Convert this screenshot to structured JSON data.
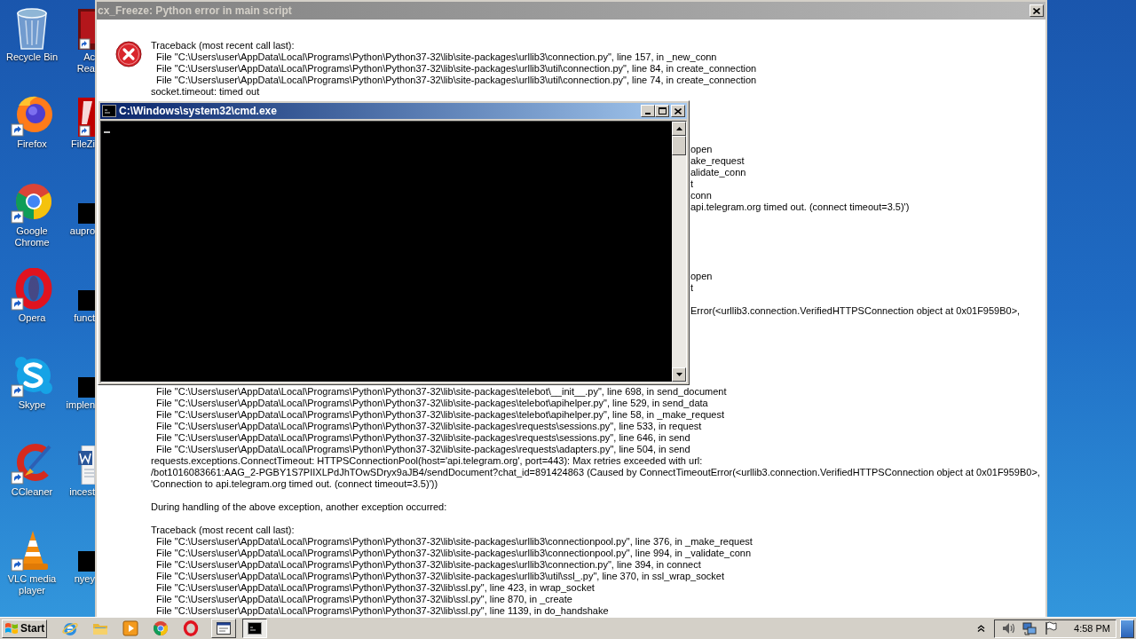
{
  "desktop": {
    "icons": [
      {
        "kind": "recycle",
        "label": "Recycle Bin"
      },
      {
        "kind": "firefox",
        "label": "Firefox"
      },
      {
        "kind": "chrome",
        "label": "Google Chrome"
      },
      {
        "kind": "opera",
        "label": "Opera"
      },
      {
        "kind": "skype",
        "label": "Skype"
      },
      {
        "kind": "ccleaner",
        "label": "CCleaner"
      },
      {
        "kind": "vlc",
        "label": "VLC media player"
      }
    ],
    "partial_icons": [
      {
        "kind": "reader",
        "label_lines": [
          "Ac",
          "Rea"
        ]
      },
      {
        "kind": "filezilla",
        "label_lines": [
          "FileZi"
        ]
      },
      {
        "kind": "blank",
        "label_lines": [
          "aupro"
        ]
      },
      {
        "kind": "blank",
        "label_lines": [
          "funct"
        ]
      },
      {
        "kind": "blank",
        "label_lines": [
          "implen"
        ]
      },
      {
        "kind": "document",
        "label_lines": [
          "incest"
        ]
      },
      {
        "kind": "blank",
        "label_lines": [
          "nyey"
        ]
      }
    ]
  },
  "dialog": {
    "title": "cx_Freeze: Python error in main script",
    "lines_above": [
      {
        "kind": "text",
        "text": "Traceback (most recent call last):"
      },
      {
        "kind": "frame",
        "text": "File \"C:\\Users\\user\\AppData\\Local\\Programs\\Python\\Python37-32\\lib\\site-packages\\urllib3\\connection.py\", line 157, in _new_conn"
      },
      {
        "kind": "frame",
        "text": "File \"C:\\Users\\user\\AppData\\Local\\Programs\\Python\\Python37-32\\lib\\site-packages\\urllib3\\util\\connection.py\", line 84, in create_connection"
      },
      {
        "kind": "frame",
        "text": "File \"C:\\Users\\user\\AppData\\Local\\Programs\\Python\\Python37-32\\lib\\site-packages\\urllib3\\util\\connection.py\", line 74, in create_connection"
      },
      {
        "kind": "text",
        "text": "socket.timeout: timed out"
      }
    ],
    "visible_fragments": [
      [
        "open",
        "ake_request",
        "alidate_conn",
        "t",
        "conn",
        "api.telegram.org timed out. (connect timeout=3.5)')"
      ],
      [
        "open",
        "t"
      ],
      [
        "Error(<urllib3.connection.VerifiedHTTPSConnection object at 0x01F959B0>,"
      ]
    ],
    "blocks_below": [
      [
        {
          "kind": "frame",
          "text": "File \"C:\\Users\\user\\AppData\\Local\\Programs\\Python\\Python37-32\\lib\\site-packages\\telebot\\__init__.py\", line 698, in send_document"
        },
        {
          "kind": "frame",
          "text": "File \"C:\\Users\\user\\AppData\\Local\\Programs\\Python\\Python37-32\\lib\\site-packages\\telebot\\apihelper.py\", line 529, in send_data"
        },
        {
          "kind": "frame",
          "text": "File \"C:\\Users\\user\\AppData\\Local\\Programs\\Python\\Python37-32\\lib\\site-packages\\telebot\\apihelper.py\", line 58, in _make_request"
        },
        {
          "kind": "frame",
          "text": "File \"C:\\Users\\user\\AppData\\Local\\Programs\\Python\\Python37-32\\lib\\site-packages\\requests\\sessions.py\", line 533, in request"
        },
        {
          "kind": "frame",
          "text": "File \"C:\\Users\\user\\AppData\\Local\\Programs\\Python\\Python37-32\\lib\\site-packages\\requests\\sessions.py\", line 646, in send"
        },
        {
          "kind": "frame",
          "text": "File \"C:\\Users\\user\\AppData\\Local\\Programs\\Python\\Python37-32\\lib\\site-packages\\requests\\adapters.py\", line 504, in send"
        },
        {
          "kind": "text",
          "text": "requests.exceptions.ConnectTimeout: HTTPSConnectionPool(host='api.telegram.org', port=443): Max retries exceeded with url:"
        },
        {
          "kind": "text",
          "text": "/bot1016083661:AAG_2-PGBY1S7PIIXLPdJhTOwSDryx9aJB4/sendDocument?chat_id=891424863 (Caused by ConnectTimeoutError(<urllib3.connection.VerifiedHTTPSConnection object at 0x01F959B0>,"
        },
        {
          "kind": "text",
          "text": "'Connection to api.telegram.org timed out. (connect timeout=3.5)'))"
        }
      ],
      [
        {
          "kind": "text",
          "text": "During handling of the above exception, another exception occurred:"
        }
      ],
      [
        {
          "kind": "text",
          "text": "Traceback (most recent call last):"
        },
        {
          "kind": "frame",
          "text": "File \"C:\\Users\\user\\AppData\\Local\\Programs\\Python\\Python37-32\\lib\\site-packages\\urllib3\\connectionpool.py\", line 376, in _make_request"
        },
        {
          "kind": "frame",
          "text": "File \"C:\\Users\\user\\AppData\\Local\\Programs\\Python\\Python37-32\\lib\\site-packages\\urllib3\\connectionpool.py\", line 994, in _validate_conn"
        },
        {
          "kind": "frame",
          "text": "File \"C:\\Users\\user\\AppData\\Local\\Programs\\Python\\Python37-32\\lib\\site-packages\\urllib3\\connection.py\", line 394, in connect"
        },
        {
          "kind": "frame",
          "text": "File \"C:\\Users\\user\\AppData\\Local\\Programs\\Python\\Python37-32\\lib\\site-packages\\urllib3\\util\\ssl_.py\", line 370, in ssl_wrap_socket"
        },
        {
          "kind": "frame",
          "text": "File \"C:\\Users\\user\\AppData\\Local\\Programs\\Python\\Python37-32\\lib\\ssl.py\", line 423, in wrap_socket"
        },
        {
          "kind": "frame",
          "text": "File \"C:\\Users\\user\\AppData\\Local\\Programs\\Python\\Python37-32\\lib\\ssl.py\", line 870, in _create"
        },
        {
          "kind": "frame",
          "text": "File \"C:\\Users\\user\\AppData\\Local\\Programs\\Python\\Python37-32\\lib\\ssl.py\", line 1139, in do_handshake"
        }
      ]
    ]
  },
  "console": {
    "title": "C:\\Windows\\system32\\cmd.exe"
  },
  "taskbar": {
    "start": "Start",
    "quick_launch": [
      {
        "kind": "ie"
      },
      {
        "kind": "folder"
      },
      {
        "kind": "media"
      },
      {
        "kind": "chrome"
      },
      {
        "kind": "opera"
      }
    ],
    "tasks": [
      {
        "kind": "dialog",
        "selected": false
      },
      {
        "kind": "console",
        "selected": true
      }
    ],
    "tray": [
      {
        "kind": "volume"
      },
      {
        "kind": "network"
      },
      {
        "kind": "flag"
      }
    ],
    "clock": "4:58 PM"
  }
}
